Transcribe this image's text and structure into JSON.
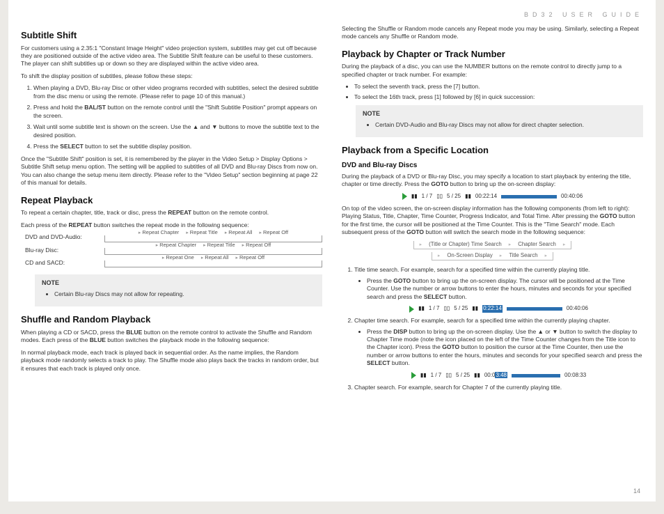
{
  "header": "BD32 USER GUIDE",
  "pagenum": "14",
  "left": {
    "h_subshift": "Subtitle Shift",
    "sub_p1": "For customers using a 2.35:1 \"Constant Image Height\" video projection system, subtitles may get cut off because they are positioned outside of the active video area. The Subtitle Shift feature can be useful to these customers. The player can shift subtitles up or down so they are displayed within the active video area.",
    "sub_p2": "To shift the display position of subtitles, please follow these steps:",
    "sub_li1a": "When playing a DVD, Blu-ray Disc or other video programs recorded with subtitles, select the desired subtitle from the disc menu or using the remote. (Please refer to page 10 of this manual.)",
    "sub_li2a": "Press and hold the ",
    "sub_li2b": "BAL/ST",
    "sub_li2c": " button on the remote control until the \"Shift Subtitle Position\" prompt appears on the screen.",
    "sub_li3": "Wait until some subtitle text is shown on the screen. Use the ▲ and ▼ buttons to move the subtitle text to the desired position.",
    "sub_li4a": "Press the ",
    "sub_li4b": "SELECT",
    "sub_li4c": " button to set the subtitle display position.",
    "sub_p3": "Once the \"Subtitle Shift\" position is set, it is remembered by the player in the Video Setup > Display Options > Subtitle Shift setup menu option. The setting will be applied to subtitles of all DVD and Blu-ray Discs from now on. You can also change the setup menu item directly. Please refer to the \"Video Setup\" section beginning at page 22 of this manual for details.",
    "h_repeat": "Repeat Playback",
    "rep_p1a": "To repeat a certain chapter, title, track or disc, press the ",
    "rep_p1b": "REPEAT",
    "rep_p1c": " button on the remote control.",
    "rep_p2a": "Each press of the ",
    "rep_p2b": "REPEAT",
    "rep_p2c": " button switches the repeat mode in the following sequence:",
    "seq": {
      "r1_label": "DVD and DVD-Audio:",
      "r1_items": [
        "Repeat Chapter",
        "Repeat Title",
        "Repeat All",
        "Repeat Off"
      ],
      "r2_label": "Blu-ray Disc:",
      "r2_items": [
        "Repeat Chapter",
        "Repeat Title",
        "Repeat Off"
      ],
      "r3_label": "CD and SACD:",
      "r3_items": [
        "Repeat One",
        "Repeat All",
        "Repeat Off"
      ]
    },
    "note1_label": "NOTE",
    "note1_txt": "Certain Blu-ray Discs may not allow for repeating.",
    "h_shuffle": "Shuffle and Random Playback",
    "shf_p1a": "When playing a CD or SACD, press the ",
    "shf_p1b": "BLUE",
    "shf_p1c": " button on the remote control to activate the Shuffle and Random modes. Each press of the ",
    "shf_p1d": "BLUE",
    "shf_p1e": " button switches the playback mode in the following sequence:",
    "shf_p2": "In normal playback mode, each track is played back in sequential order. As the name implies, the Random playback mode randomly selects a track to play. The Shuffle mode also plays back the tracks in random order, but it ensures that each track is played only once."
  },
  "right": {
    "top_p": "Selecting the Shuffle or Random mode cancels any Repeat mode you may be using. Similarly, selecting a Repeat mode cancels any Shuffle or Random mode.",
    "h_chap": "Playback by Chapter or Track Number",
    "chap_p1": "During the playback of a disc, you can use the NUMBER buttons on the remote control to directly jump to a specified chapter or track number. For example:",
    "chap_li1": "To select the seventh track, press the [7] button.",
    "chap_li2": "To select the 16th track, press [1] followed by [6] in quick succession:",
    "note2_label": "NOTE",
    "note2_txt": "Certain DVD-Audio and Blu-ray Discs may not allow for direct chapter selection.",
    "h_loc": "Playback from a Specific Location",
    "h_dvd": "DVD and Blu-ray Discs",
    "loc_p1a": "During the playback of a DVD or Blu-ray Disc, you may specify a location to start playback by entering the title, chapter or time directly. Press the ",
    "loc_p1b": "GOTO",
    "loc_p1c": " button to bring up the on-screen display:",
    "osd1": {
      "title": "1 / 7",
      "chap": "5 / 25",
      "t1": "00:22:14",
      "t2": "00:40:06"
    },
    "loc_p2a": "On top of the video screen, the on-screen display information has the following components (from left to right): Playing Status, Title, Chapter, Time Counter, Progress Indicator, and Total Time. After pressing the ",
    "loc_p2b": "GOTO",
    "loc_p2c": " button for the first time, the cursor will be positioned at the Time Counter. This is the \"Time Search\" mode. Each subsequent press of the ",
    "loc_p2d": "GOTO",
    "loc_p2e": " button will switch the search mode in the following sequence:",
    "flow": {
      "a1": "(Title or Chapter) Time Search",
      "a2": "Chapter Search",
      "b1": "On-Screen Display",
      "b2": "Title Search"
    },
    "ol1": "Title time search. For example, search for a specified time within the currently playing title.",
    "ol1_suba": "Press the ",
    "ol1_subb": "GOTO",
    "ol1_subc": " button to bring up the on-screen display. The cursor will be positioned at the Time Counter. Use the number or arrow buttons to enter the hours, minutes and seconds for your specified search and press the ",
    "ol1_subd": "SELECT",
    "ol1_sube": " button.",
    "osd2": {
      "title": "1 / 7",
      "chap": "5 / 25",
      "t1": "0:22:14",
      "t2": "00:40:06"
    },
    "ol2": "Chapter time search. For example, search for a specified time within the currently playing chapter.",
    "ol2_suba": "Press the ",
    "ol2_subb": "DISP",
    "ol2_subc": " button to bring up the on-screen display. Use the ▲ or ▼ button to switch the display to Chapter Time mode (note the icon placed on the left of the Time Counter changes from the Title icon to the Chapter icon). Press the ",
    "ol2_subd": "GOTO",
    "ol2_sube": " button to position the cursor at the Time Counter, then use the number or arrow buttons to enter the hours, minutes and seconds for your specified search and press the ",
    "ol2_subf": "SELECT",
    "ol2_subg": " button.",
    "osd3": {
      "title": "1 / 7",
      "chap": "5 / 25",
      "t1a": "00:0",
      "t1b": "3:48",
      "t2": "00:08:33"
    },
    "ol3": "Chapter search. For example, search for Chapter 7 of the currently playing title."
  }
}
